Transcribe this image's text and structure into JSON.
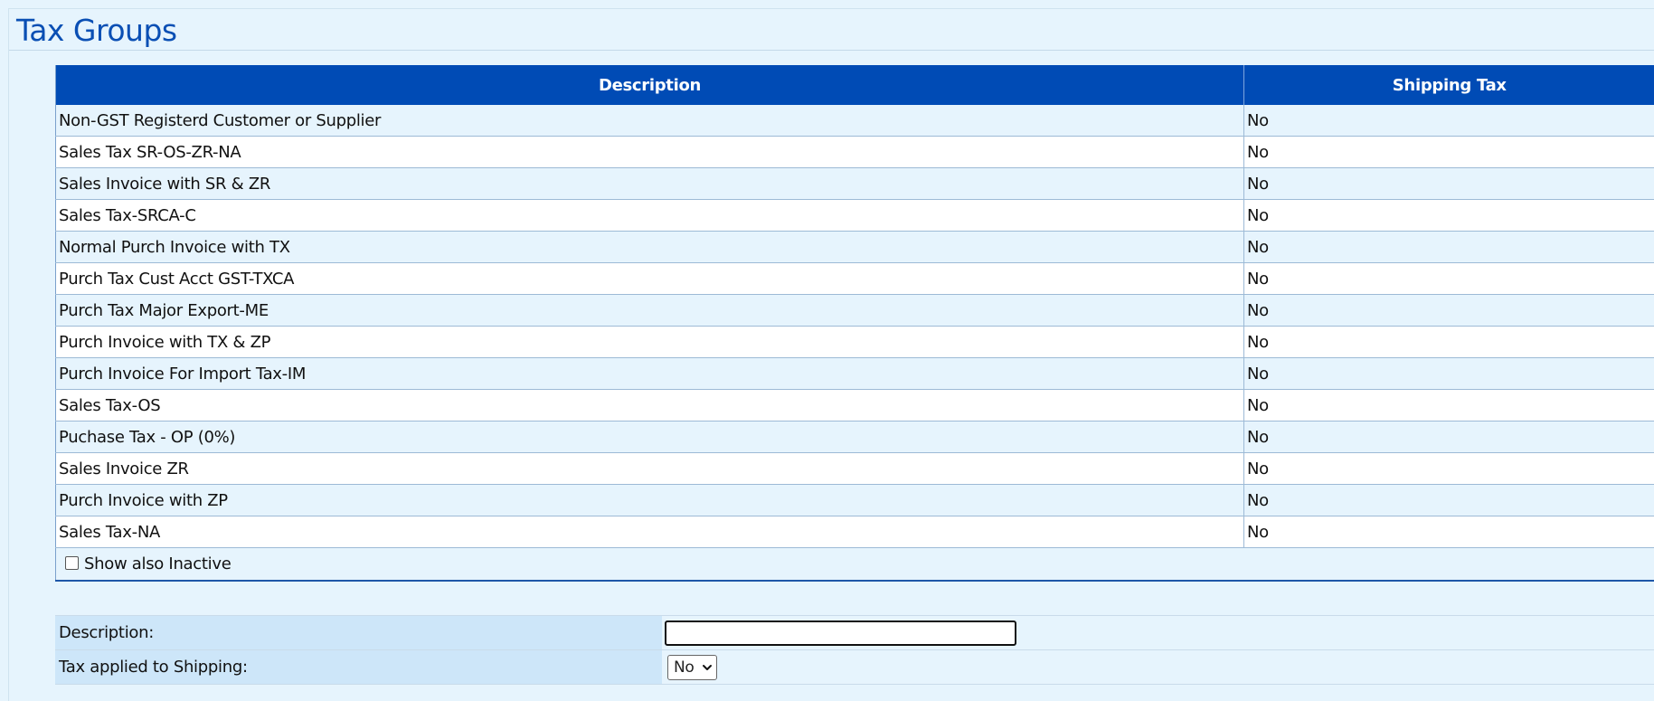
{
  "page": {
    "title": "Tax Groups"
  },
  "grid": {
    "columns": [
      "Description",
      "Shipping Tax"
    ],
    "rows": [
      {
        "description": "Non-GST Registerd Customer or Supplier",
        "shipping_tax": "No"
      },
      {
        "description": "Sales Tax SR-OS-ZR-NA",
        "shipping_tax": "No"
      },
      {
        "description": "Sales Invoice with SR & ZR",
        "shipping_tax": "No"
      },
      {
        "description": "Sales Tax-SRCA-C",
        "shipping_tax": "No"
      },
      {
        "description": "Normal Purch Invoice with TX",
        "shipping_tax": "No"
      },
      {
        "description": "Purch Tax Cust Acct GST-TXCA",
        "shipping_tax": "No"
      },
      {
        "description": "Purch Tax Major Export-ME",
        "shipping_tax": "No"
      },
      {
        "description": "Purch Invoice with TX & ZP",
        "shipping_tax": "No"
      },
      {
        "description": "Purch Invoice For Import Tax-IM",
        "shipping_tax": "No"
      },
      {
        "description": "Sales Tax-OS",
        "shipping_tax": "No"
      },
      {
        "description": "Puchase Tax - OP (0%)",
        "shipping_tax": "No"
      },
      {
        "description": "Sales Invoice ZR",
        "shipping_tax": "No"
      },
      {
        "description": "Purch Invoice with ZP",
        "shipping_tax": "No"
      },
      {
        "description": "Sales Tax-NA",
        "shipping_tax": "No"
      }
    ],
    "show_inactive_label": "Show also Inactive",
    "show_inactive_checked": false
  },
  "form": {
    "description_label": "Description:",
    "description_value": "",
    "shipping_label": "Tax applied to Shipping:",
    "shipping_selected": "No"
  },
  "colors": {
    "header_bg": "#004bb5",
    "title": "#0a4fb4",
    "page_bg": "#e6f4fd"
  }
}
